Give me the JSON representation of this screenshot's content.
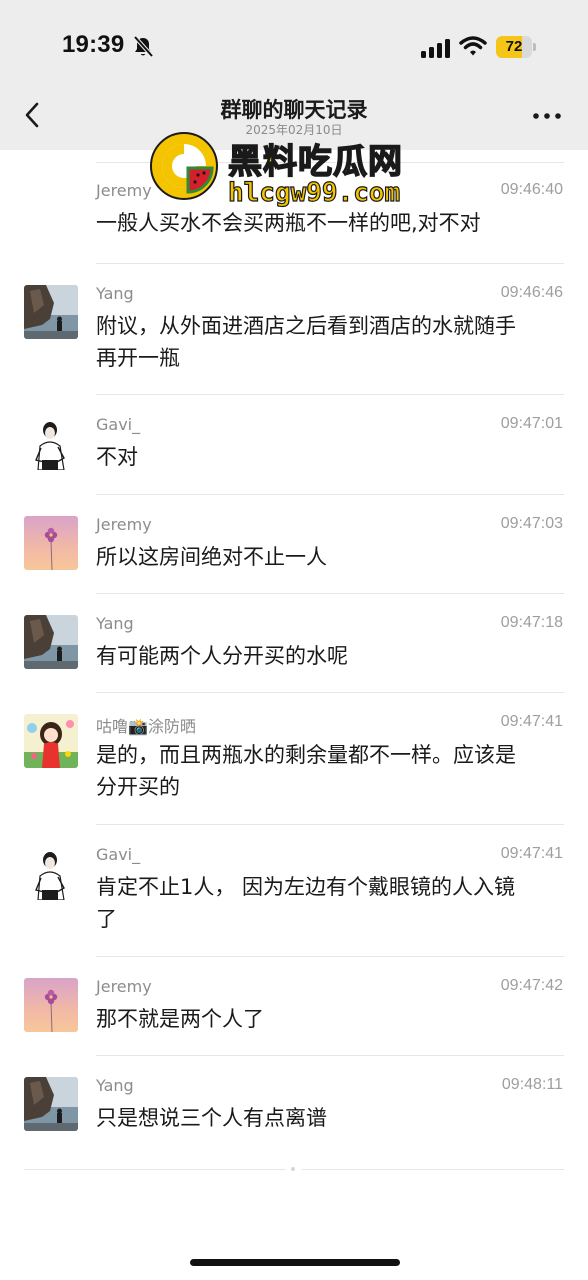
{
  "status_bar": {
    "time": "19:39",
    "battery_level": "72",
    "battery_percent": 72,
    "battery_color": "#f5c518"
  },
  "nav": {
    "title": "群聊的聊天记录",
    "subtitle": "2025年02月10日",
    "back_icon": "chevron-left-icon",
    "more_icon": "more-dots-icon"
  },
  "watermark": {
    "title": "黑料吃瓜网",
    "url": "hlcgw99.com",
    "color": "#f5c400"
  },
  "messages": [
    {
      "sender": "Jeremy",
      "time": "09:46:40",
      "text": [
        "一般人买水不会买两瓶不一样的吧,对不对"
      ],
      "avatar": "flower"
    },
    {
      "sender": "Yang",
      "time": "09:46:46",
      "text": [
        "附议，从外面进酒店之后看到酒店的水就随手",
        "再开一瓶"
      ],
      "avatar": "coast"
    },
    {
      "sender": "Gavi_",
      "time": "09:47:01",
      "text": [
        "不对"
      ],
      "avatar": "person-sketch"
    },
    {
      "sender": "Jeremy",
      "time": "09:47:03",
      "text": [
        "所以这房间绝对不止一人"
      ],
      "avatar": "flower"
    },
    {
      "sender": "Yang",
      "time": "09:47:18",
      "text": [
        "有可能两个人分开买的水呢"
      ],
      "avatar": "coast"
    },
    {
      "sender": "咕噜📸涂防晒",
      "time": "09:47:41",
      "text": [
        "是的，而且两瓶水的剩余量都不一样。应该是",
        "分开买的"
      ],
      "avatar": "cartoon-girl"
    },
    {
      "sender": "Gavi_",
      "time": "09:47:41",
      "text": [
        "肯定不止1人， 因为左边有个戴眼镜的人入镜",
        "了"
      ],
      "avatar": "person-sketch"
    },
    {
      "sender": "Jeremy",
      "time": "09:47:42",
      "text": [
        "那不就是两个人了"
      ],
      "avatar": "flower"
    },
    {
      "sender": "Yang",
      "time": "09:48:11",
      "text": [
        "只是想说三个人有点离谱"
      ],
      "avatar": "coast"
    }
  ]
}
